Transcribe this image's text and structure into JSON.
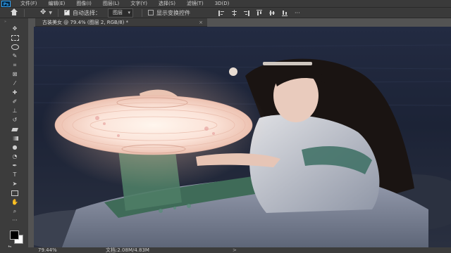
{
  "app": {
    "logo": "Ps"
  },
  "menu": [
    "文件(F)",
    "编辑(E)",
    "图像(I)",
    "图层(L)",
    "文字(Y)",
    "选择(S)",
    "滤镜(T)",
    "3D(D)"
  ],
  "options": {
    "auto_select_label": "自动选择：",
    "auto_select_checked": true,
    "target_dropdown": "图层",
    "show_transform_label": "显示变换控件",
    "show_transform_checked": false
  },
  "document_tab": {
    "title": "古装美女 @ 79.4% (图层 2, RGB/8) *",
    "close": "×"
  },
  "toolbox": {
    "tools": [
      "move-tool",
      "marquee-tool",
      "lasso-tool",
      "quick-select-tool",
      "crop-tool",
      "frame-tool",
      "eyedropper-tool",
      "healing-brush-tool",
      "brush-tool",
      "clone-stamp-tool",
      "history-brush-tool",
      "eraser-tool",
      "gradient-tool",
      "blur-tool",
      "dodge-tool",
      "pen-tool",
      "type-tool",
      "path-select-tool",
      "rectangle-tool",
      "hand-tool",
      "zoom-tool",
      "edit-toolbar"
    ],
    "foreground_color": "#000000",
    "background_color": "#ffffff"
  },
  "status": {
    "zoom": "79.44%",
    "doc_info": "文档:2.08M/4.83M",
    "arrow": ">"
  },
  "colors": {
    "chrome_dark": "#3a3a3a",
    "workspace": "#535353",
    "lantern_glow": "#fbe6de"
  }
}
